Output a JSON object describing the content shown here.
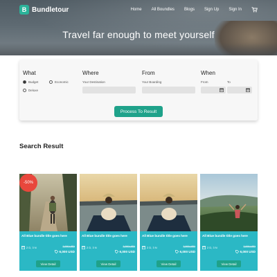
{
  "brand": {
    "logo_letter": "B",
    "name": "Bundletour"
  },
  "nav": {
    "items": [
      "Home",
      "All Boundles",
      "Blogs",
      "Sign Up",
      "Sign In"
    ],
    "cart_icon": "cart-icon"
  },
  "hero": {
    "tagline": "Travel far enough to meet yourself"
  },
  "search": {
    "what": {
      "title": "What",
      "options": [
        {
          "label": "Budget",
          "selected": true
        },
        {
          "label": "Economic",
          "selected": false
        },
        {
          "label": "Deluxe",
          "selected": false
        }
      ]
    },
    "where": {
      "title": "Where",
      "label": "Your Destination",
      "value": ""
    },
    "from": {
      "title": "From",
      "label": "Your Boarding",
      "value": ""
    },
    "when": {
      "title": "When",
      "from_label": "From",
      "to_label": "To",
      "from_value": "",
      "to_value": ""
    },
    "submit_label": "Process To Result"
  },
  "results": {
    "title": "Search Result",
    "cards": [
      {
        "badge": "-50%",
        "title": "All Blue bundle title goes here",
        "duration": "2 D, 3 N",
        "old_price": "7,000 USD",
        "price": "6,000 USD",
        "button": "View Detail"
      },
      {
        "badge": "",
        "title": "All Blue bundle title goes here",
        "duration": "2 D, 3 N",
        "old_price": "7,000 USD",
        "price": "6,000 USD",
        "button": "View Detail"
      },
      {
        "badge": "",
        "title": "All Blue bundle title goes here",
        "duration": "2 D, 3 N",
        "old_price": "7,000 USD",
        "price": "6,000 USD",
        "button": "View Detail"
      },
      {
        "badge": "",
        "title": "All Blue bundle title goes here",
        "duration": "2 D, 3 N",
        "old_price": "7,000 USD",
        "price": "6,000 USD",
        "button": "View Detail"
      }
    ]
  },
  "colors": {
    "accent": "#1fa28a",
    "card_bg": "#2bb8c5",
    "badge": "#e8473c",
    "brand_logo": "#2bb39a"
  }
}
